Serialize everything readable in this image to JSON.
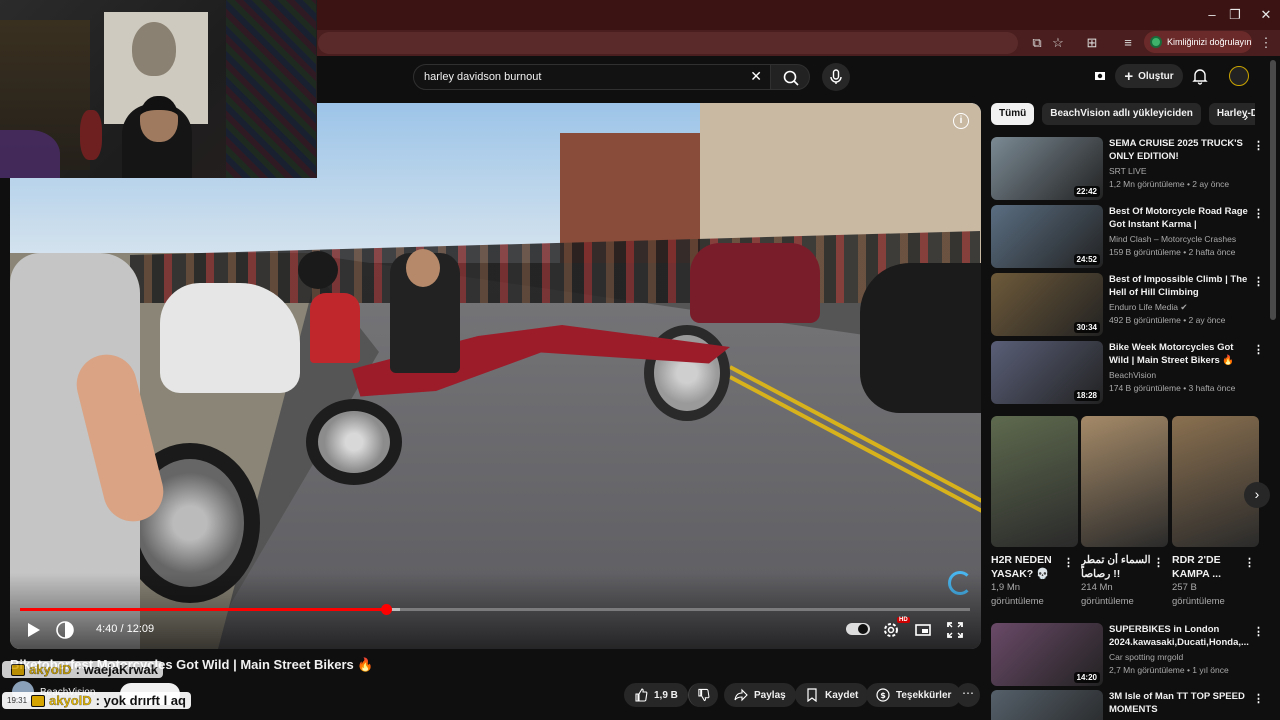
{
  "browser": {
    "window_controls": [
      "–",
      "❐",
      "✕"
    ],
    "profile_label": "Kimliğinizi doğrulayın"
  },
  "masthead": {
    "search_value": "harley davidson burnout",
    "create_label": "Oluştur"
  },
  "player": {
    "time_display": "4:40 / 12:09",
    "progress": 0.385,
    "buffered": 0.4,
    "autoplay_on": true
  },
  "video": {
    "title": "Biketoberfest Motorcycles Got Wild | Main Street Bikers 🔥",
    "channel": "BeachVision",
    "actions": {
      "likes": "1,9 B",
      "share": "Paylaş",
      "save": "Kaydet",
      "thanks": "Teşekkürler"
    }
  },
  "chat": [
    {
      "time": "",
      "user": "akyolD",
      "text": ": waejaKrwak"
    },
    {
      "time": "19:31",
      "user": "akyolD",
      "text": ": yok drırft l aq"
    }
  ],
  "sidebar": {
    "chips": [
      "Tümü",
      "BeachVision adlı yükleyiciden",
      "Harley-D"
    ],
    "recommendations": [
      {
        "title": "SEMA CRUISE 2025 TRUCK'S ONLY EDITION!",
        "channel": "SRT LIVE",
        "meta": "1,2 Mn görüntüleme • 2 ay önce",
        "duration": "22:42",
        "color": "#7b8a94"
      },
      {
        "title": "Best Of Motorcycle Road Rage Got Instant Karma | Motorcycl...",
        "channel": "Mind Clash – Motorcycle Crashes",
        "meta": "159 B görüntüleme • 2 hafta önce",
        "duration": "24:52",
        "color": "#5a6e82"
      },
      {
        "title": "Best of Impossible Climb | The Hell of Hill Climbing",
        "channel": "Enduro Life Media ✔",
        "meta": "492 B görüntüleme • 2 ay önce",
        "duration": "30:34",
        "color": "#6e5a3a"
      },
      {
        "title": "Bike Week Motorcycles Got Wild | Main Street Bikers 🔥",
        "channel": "BeachVision",
        "meta": "174 B görüntüleme • 3 hafta önce",
        "duration": "18:28",
        "color": "#5a5f78"
      },
      {
        "title": "SUPERBIKES in London 2024.kawasaki,Ducati,Honda,...",
        "channel": "Car spotting mrgold",
        "meta": "2,7 Mn görüntüleme • 1 yıl önce",
        "duration": "14:20",
        "color": "#6a4a68"
      },
      {
        "title": "3M Isle of Man TT TOP SPEED MOMENTS",
        "channel": "",
        "meta": "",
        "duration": "",
        "color": "#55606a"
      }
    ],
    "shorts": [
      {
        "title": "H2R NEDEN YASAK? 💀",
        "views": "1,9 Mn görüntüleme",
        "color": "#5e6a4e"
      },
      {
        "title": "السماء أن تمطر رصاصاً !!",
        "views": "214 Mn görüntüleme",
        "color": "#a58a68"
      },
      {
        "title": "RDR 2'DE KAMPA ...",
        "views": "257 B görüntüleme",
        "color": "#8a7050"
      }
    ]
  }
}
